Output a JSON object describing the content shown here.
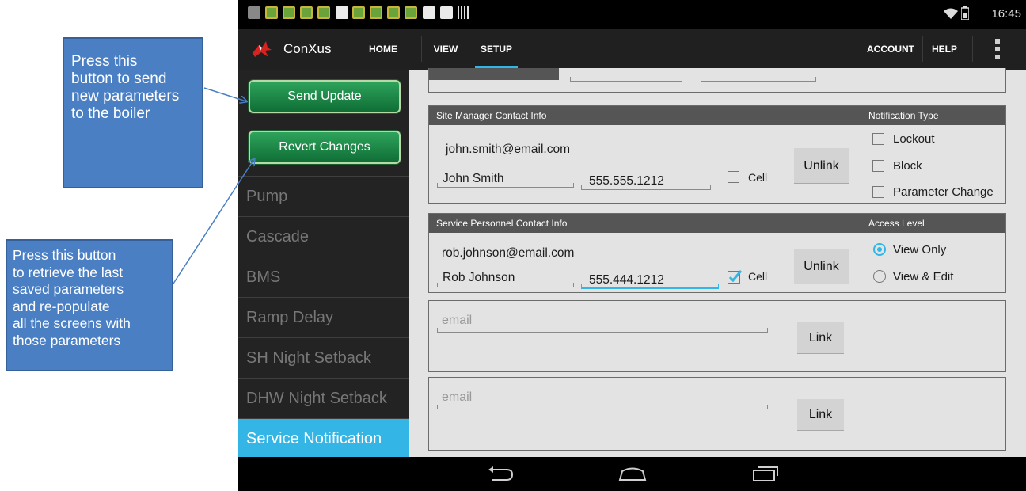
{
  "callouts": {
    "send_update": "Press this\nbutton to send\nnew parameters\nto the boiler",
    "revert": "Press this button\nto retrieve the last\nsaved parameters\nand re-populate\nall the screens with\nthose parameters"
  },
  "status_bar": {
    "time": "16:45"
  },
  "app": {
    "name": "ConXus",
    "nav": {
      "home": "HOME",
      "view": "VIEW",
      "setup": "SETUP",
      "account": "ACCOUNT",
      "help": "HELP"
    },
    "active_tab": "SETUP",
    "accent_color": "#33b5e5"
  },
  "sidebar": {
    "send_update": "Send Update",
    "revert_changes": "Revert Changes",
    "items": [
      "Pump",
      "Cascade",
      "BMS",
      "Ramp Delay",
      "SH Night Setback",
      "DHW Night Setback",
      "Service Notification"
    ],
    "active_item": "Service Notification"
  },
  "site_manager": {
    "header": "Site Manager Contact Info",
    "notification_header": "Notification Type",
    "email": "john.smith@email.com",
    "name": "John Smith",
    "phone": "555.555.1212",
    "cell_label": "Cell",
    "cell_checked": false,
    "button": "Unlink",
    "notifications": [
      {
        "label": "Lockout",
        "checked": false
      },
      {
        "label": "Block",
        "checked": false
      },
      {
        "label": "Parameter Change",
        "checked": false
      }
    ]
  },
  "service_personnel": {
    "header": "Service Personnel Contact Info",
    "access_header": "Access Level",
    "email": "rob.johnson@email.com",
    "name": "Rob Johnson",
    "phone": "555.444.1212",
    "cell_label": "Cell",
    "cell_checked": true,
    "button": "Unlink",
    "access_levels": [
      {
        "label": "View Only",
        "selected": true
      },
      {
        "label": "View & Edit",
        "selected": false
      }
    ]
  },
  "empty_slots": [
    {
      "placeholder": "email",
      "button": "Link"
    },
    {
      "placeholder": "email",
      "button": "Link"
    }
  ],
  "icons": {
    "status_left": [
      "gallery-icon",
      "app-notification-icon",
      "app-notification-icon",
      "app-notification-icon",
      "app-notification-icon",
      "briefcase-icon",
      "app-notification-icon",
      "app-notification-icon",
      "app-notification-icon",
      "app-notification-icon",
      "briefcase-icon",
      "checkbox-icon",
      "barcode-icon"
    ],
    "status_right": [
      "wifi-icon",
      "battery-icon"
    ],
    "nav": [
      "back-icon",
      "home-icon",
      "recents-icon"
    ]
  }
}
